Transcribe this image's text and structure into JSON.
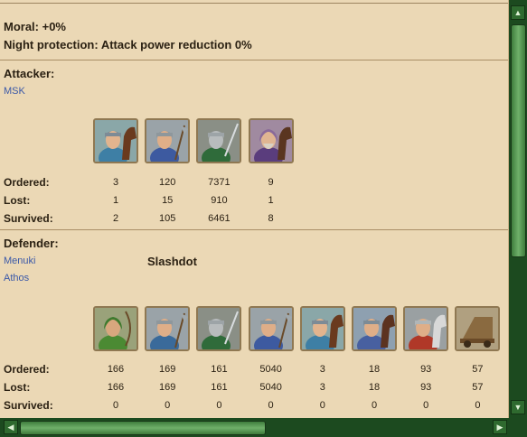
{
  "summary": {
    "moral": "Moral: +0%",
    "night_protection": "Night protection: Attack power reduction 0%"
  },
  "labels": {
    "attacker_heading": "Attacker:",
    "defender_heading": "Defender:",
    "ordered": "Ordered:",
    "lost": "Lost:",
    "survived": "Survived:"
  },
  "attacker": {
    "players": [
      "MSK"
    ],
    "units": [
      {
        "icon": "light-cavalry-icon",
        "ordered": "3",
        "lost": "1",
        "survived": "2"
      },
      {
        "icon": "axeman-icon",
        "ordered": "120",
        "lost": "15",
        "survived": "105"
      },
      {
        "icon": "swordsman-icon",
        "ordered": "7371",
        "lost": "910",
        "survived": "6461"
      },
      {
        "icon": "nobleman-icon",
        "ordered": "9",
        "lost": "1",
        "survived": "8"
      }
    ]
  },
  "defender": {
    "players": [
      "Menuki",
      "Athos"
    ],
    "village": "Slashdot",
    "units": [
      {
        "icon": "archer-icon",
        "ordered": "166",
        "lost": "166",
        "survived": "0"
      },
      {
        "icon": "spearman-icon",
        "ordered": "169",
        "lost": "169",
        "survived": "0"
      },
      {
        "icon": "swordsman-icon",
        "ordered": "161",
        "lost": "161",
        "survived": "0"
      },
      {
        "icon": "axeman-icon",
        "ordered": "5040",
        "lost": "5040",
        "survived": "0"
      },
      {
        "icon": "light-cavalry-icon",
        "ordered": "3",
        "lost": "3",
        "survived": "0"
      },
      {
        "icon": "mounted-archer-icon",
        "ordered": "18",
        "lost": "18",
        "survived": "0"
      },
      {
        "icon": "heavy-cavalry-icon",
        "ordered": "93",
        "lost": "93",
        "survived": "0"
      },
      {
        "icon": "ram-icon",
        "ordered": "57",
        "lost": "57",
        "survived": "0"
      }
    ]
  },
  "colors": {
    "parchment": "#ebd8b5",
    "link": "#3a58a8",
    "scrollbar": "#1c4a1f"
  }
}
